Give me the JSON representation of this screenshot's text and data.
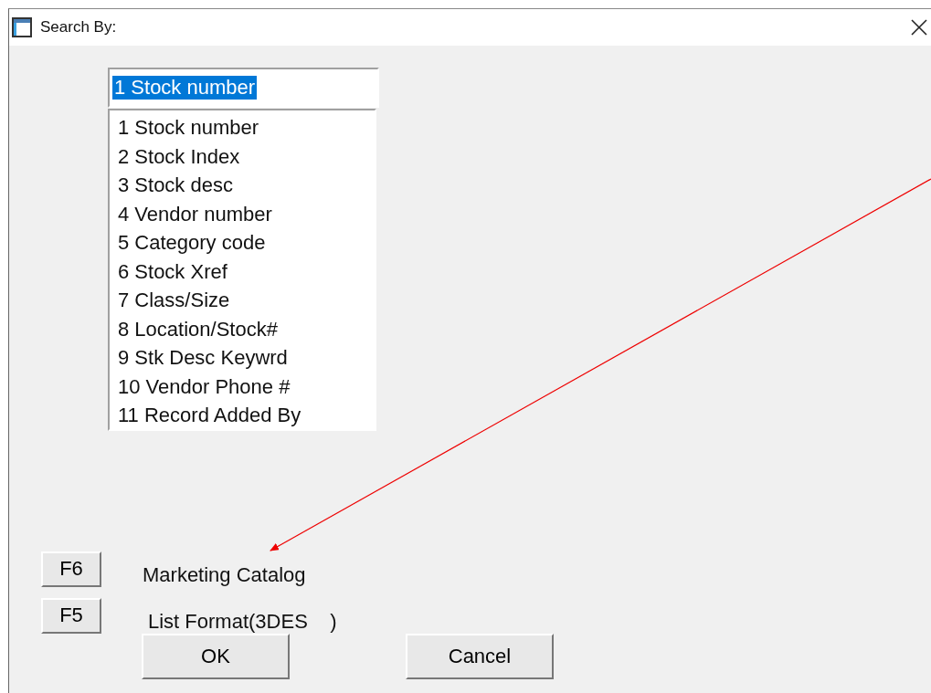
{
  "window": {
    "title": "Search By:"
  },
  "combo": {
    "value": "1 Stock number",
    "highlighted": true
  },
  "options": [
    {
      "label": "1 Stock number"
    },
    {
      "label": "2 Stock Index"
    },
    {
      "label": "3 Stock desc"
    },
    {
      "label": "4 Vendor number"
    },
    {
      "label": "5 Category code"
    },
    {
      "label": "6 Stock Xref"
    },
    {
      "label": "7 Class/Size"
    },
    {
      "label": "8 Location/Stock#"
    },
    {
      "label": "9 Stk Desc Keywrd"
    },
    {
      "label": "10 Vendor Phone #"
    },
    {
      "label": "11 Record Added By"
    }
  ],
  "function_keys": [
    {
      "key": "F6",
      "label": "Marketing Catalog"
    },
    {
      "key": "F5",
      "label": "List Format(3DES    )"
    }
  ],
  "buttons": [
    "OK",
    "Cancel"
  ]
}
